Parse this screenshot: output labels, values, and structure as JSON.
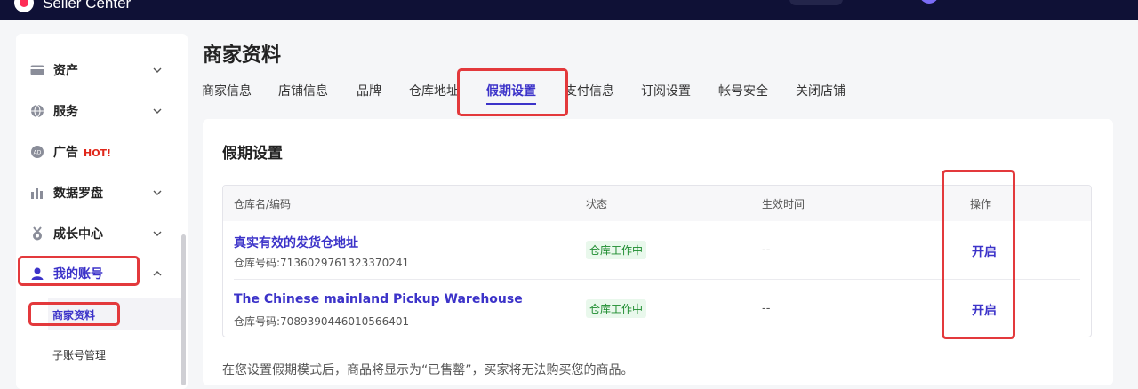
{
  "topbar": {
    "app_name": "Seller Center"
  },
  "sidebar": {
    "items": [
      {
        "label": "资产",
        "icon": "card-icon"
      },
      {
        "label": "服务",
        "icon": "globe-icon"
      },
      {
        "label": "广告",
        "icon": "ad-icon",
        "badge": "HOT!"
      },
      {
        "label": "数据罗盘",
        "icon": "bar-chart-icon"
      },
      {
        "label": "成长中心",
        "icon": "medal-icon"
      },
      {
        "label": "我的账号",
        "icon": "user-icon"
      }
    ],
    "sub_items": [
      {
        "label": "商家资料",
        "active": true
      },
      {
        "label": "子账号管理",
        "active": false
      }
    ]
  },
  "page": {
    "title": "商家资料"
  },
  "tabs": [
    {
      "label": "商家信息"
    },
    {
      "label": "店铺信息"
    },
    {
      "label": "品牌"
    },
    {
      "label": "仓库地址"
    },
    {
      "label": "假期设置",
      "active": true
    },
    {
      "label": "支付信息"
    },
    {
      "label": "订阅设置"
    },
    {
      "label": "帐号安全"
    },
    {
      "label": "关闭店铺"
    }
  ],
  "holiday": {
    "title": "假期设置",
    "columns": {
      "name": "仓库名/编码",
      "status": "状态",
      "effective": "生效时间",
      "action": "操作"
    },
    "rows": [
      {
        "name": "真实有效的发货仓地址",
        "code": "仓库号码:7136029761323370241",
        "status": "仓库工作中",
        "effective": "--",
        "action": "开启"
      },
      {
        "name": "The Chinese mainland Pickup Warehouse",
        "code": "仓库号码:7089390446010566401",
        "status": "仓库工作中",
        "effective": "--",
        "action": "开启"
      }
    ],
    "note": "在您设置假期模式后，商品将显示为“已售罄”，买家将无法购买您的商品。"
  },
  "colors": {
    "accent": "#3c33c9",
    "topbar": "#0f1136",
    "highlight": "#e3393c",
    "status_green": "#1a8a2c"
  }
}
